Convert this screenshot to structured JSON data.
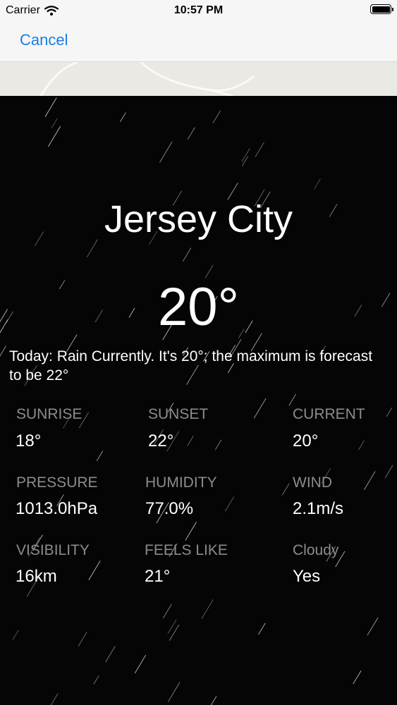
{
  "status_bar": {
    "carrier": "Carrier",
    "time": "10:57 PM"
  },
  "nav": {
    "cancel_label": "Cancel"
  },
  "weather": {
    "city": "Jersey City",
    "temperature": "20°",
    "summary": "Today: Rain Currently. It's 20°; the maximum is forecast to be 22°",
    "metrics": [
      {
        "label": "SUNRISE",
        "value": "18°"
      },
      {
        "label": "SUNSET",
        "value": "22°"
      },
      {
        "label": "CURRENT",
        "value": "20°"
      },
      {
        "label": "PRESSURE",
        "value": "1013.0hPa"
      },
      {
        "label": "HUMIDITY",
        "value": "77.0%"
      },
      {
        "label": "WIND",
        "value": "2.1m/s"
      },
      {
        "label": "VISIBILITY",
        "value": "16km"
      },
      {
        "label": "FEELS LIKE",
        "value": "21°"
      },
      {
        "label": "Cloudy",
        "value": "Yes"
      }
    ]
  },
  "colors": {
    "accent": "#1a7ee5",
    "background": "#050505",
    "label_gray": "#8c8c8c"
  },
  "icons": [
    "wifi-icon",
    "battery-icon"
  ]
}
